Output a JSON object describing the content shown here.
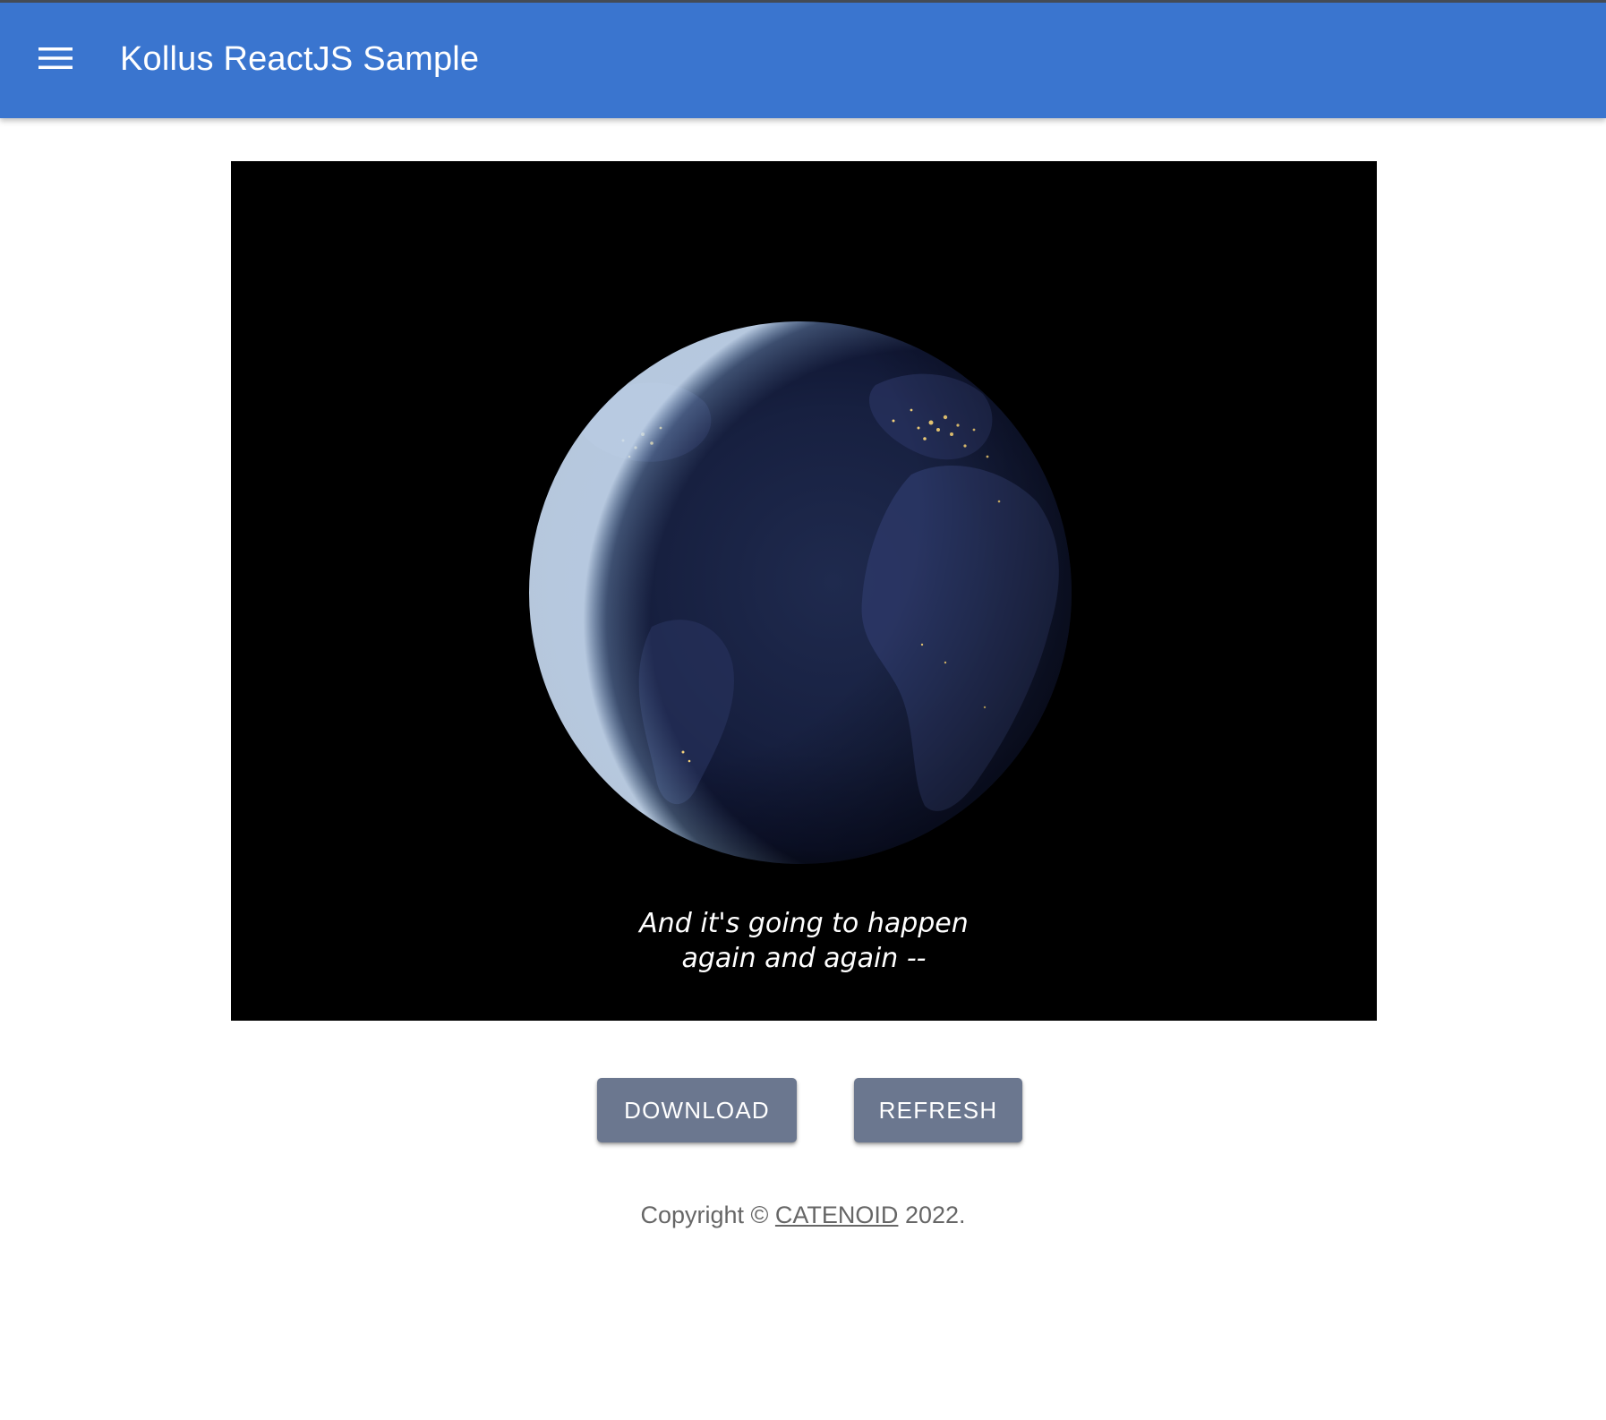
{
  "header": {
    "menu_icon": "menu-icon",
    "title": "Kollus ReactJS Sample"
  },
  "player": {
    "subtitle_line1": "And it's going to happen",
    "subtitle_line2": "again and again --"
  },
  "actions": {
    "download_label": "DOWNLOAD",
    "refresh_label": "REFRESH"
  },
  "footer": {
    "prefix": "Copyright ©",
    "link_text": "CATENOID",
    "suffix": "2022."
  },
  "colors": {
    "app_bar": "#3a75cf",
    "button": "#6b778f",
    "footer_text": "#666666"
  }
}
